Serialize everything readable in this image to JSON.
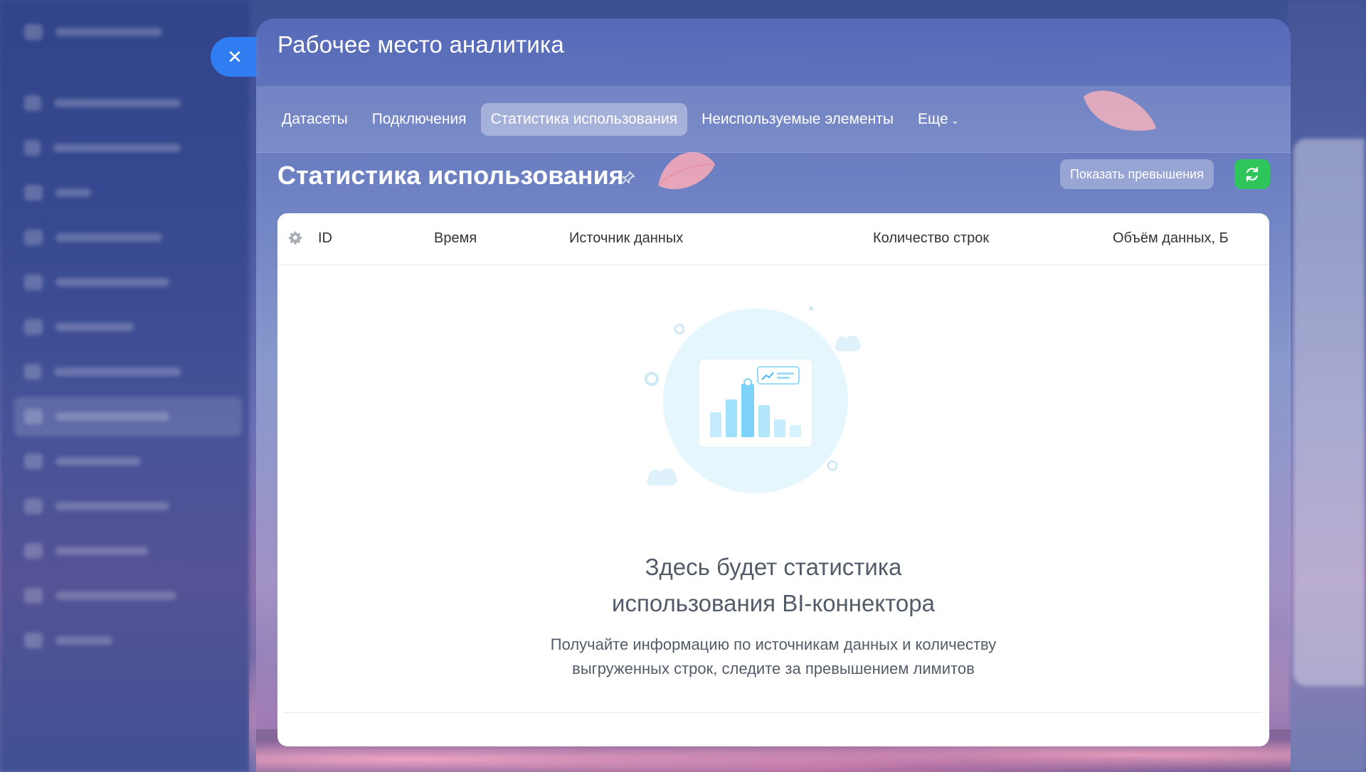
{
  "close_button": {
    "icon": "close-icon",
    "symbol": "✕"
  },
  "panel": {
    "title": "Рабочее место аналитика",
    "tabs": [
      {
        "label": "Датасеты",
        "active": false
      },
      {
        "label": "Подключения",
        "active": false
      },
      {
        "label": "Статистика использования",
        "active": true
      },
      {
        "label": "Неиспользуемые элементы",
        "active": false
      },
      {
        "label": "Еще",
        "active": false,
        "dropdown": true
      }
    ],
    "section_title": "Статистика использования",
    "actions": {
      "show_exceed_label": "Показать превышения",
      "refresh_icon": "refresh-icon",
      "refresh_color": "#2ec55a"
    }
  },
  "table": {
    "settings_icon": "gear-icon",
    "columns": [
      "ID",
      "Время",
      "Источник данных",
      "Количество строк",
      "Объём данных, Б"
    ],
    "rows": [],
    "empty_state": {
      "title_line1": "Здесь будет статистика",
      "title_line2": "использования BI-коннектора",
      "desc_line1": "Получайте информацию по источникам данных и количеству",
      "desc_line2": "выгруженных строк, следите за превышением лимитов"
    }
  },
  "colors": {
    "accent_blue": "#2f7df0",
    "text_muted": "#525c69"
  }
}
